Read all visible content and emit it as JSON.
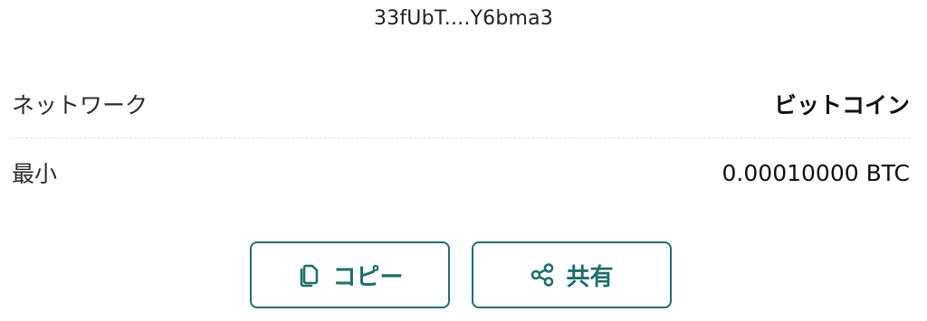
{
  "address": {
    "short": "33fUbT....Y6bma3"
  },
  "details": [
    {
      "label": "ネットワーク",
      "value": "ビットコイン"
    },
    {
      "label": "最小",
      "value": "0.00010000 BTC"
    }
  ],
  "actions": {
    "copy_label": "コピー",
    "share_label": "共有"
  },
  "colors": {
    "accent": "#1f6f6c",
    "divider": "#dddddd"
  },
  "icons": {
    "copy": "copy-icon",
    "share": "share-icon"
  }
}
